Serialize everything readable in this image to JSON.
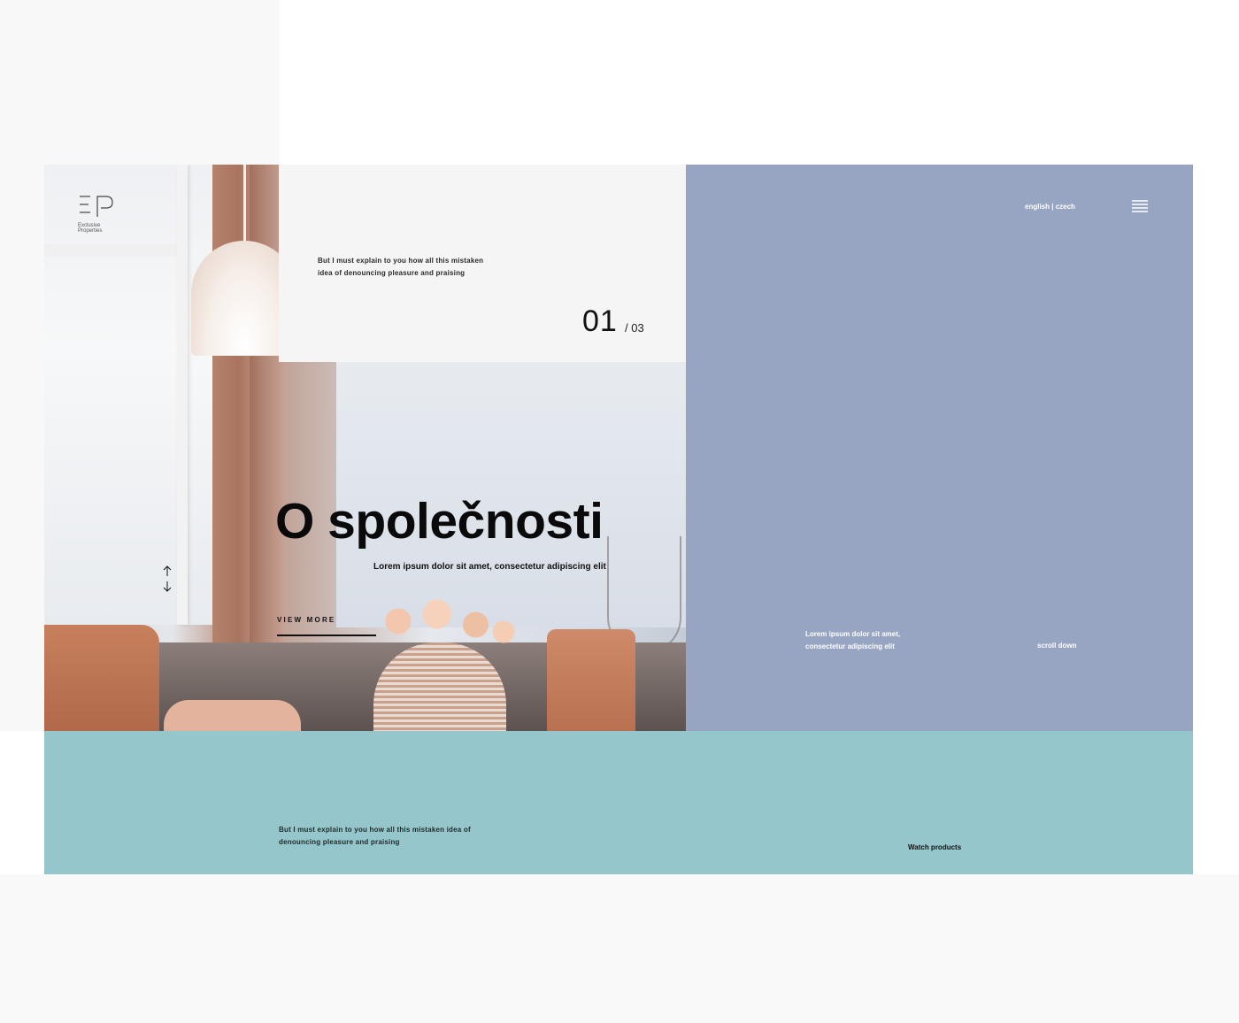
{
  "brand": {
    "logo_text_line1": "Exclusive",
    "logo_text_line2": "Properties"
  },
  "intro_card": {
    "text": "But I must explain to you how all this mistaken idea of denouncing pleasure and praising",
    "slide_current": "01",
    "slide_total": "/ 03"
  },
  "hero": {
    "title": "O společnosti",
    "subtitle": "Lorem ipsum dolor sit amet, consectetur adipiscing elit",
    "cta_label": "VIEW MORE"
  },
  "side_panel": {
    "language_switch": "english | czech",
    "text": "Lorem ipsum dolor sit amet, consectetur adipiscing elit",
    "scroll_label": "scroll down"
  },
  "footer_band": {
    "text": "But I must explain to you how all this mistaken idea of denouncing pleasure and praising",
    "watch_label": "Watch products"
  },
  "icons": [
    "ep-logo",
    "scroll-arrows-icon",
    "hamburger-menu-icon"
  ],
  "colors": {
    "panel": "#98a5c2",
    "band": "#95c6cb",
    "card": "#f5f5f5"
  }
}
